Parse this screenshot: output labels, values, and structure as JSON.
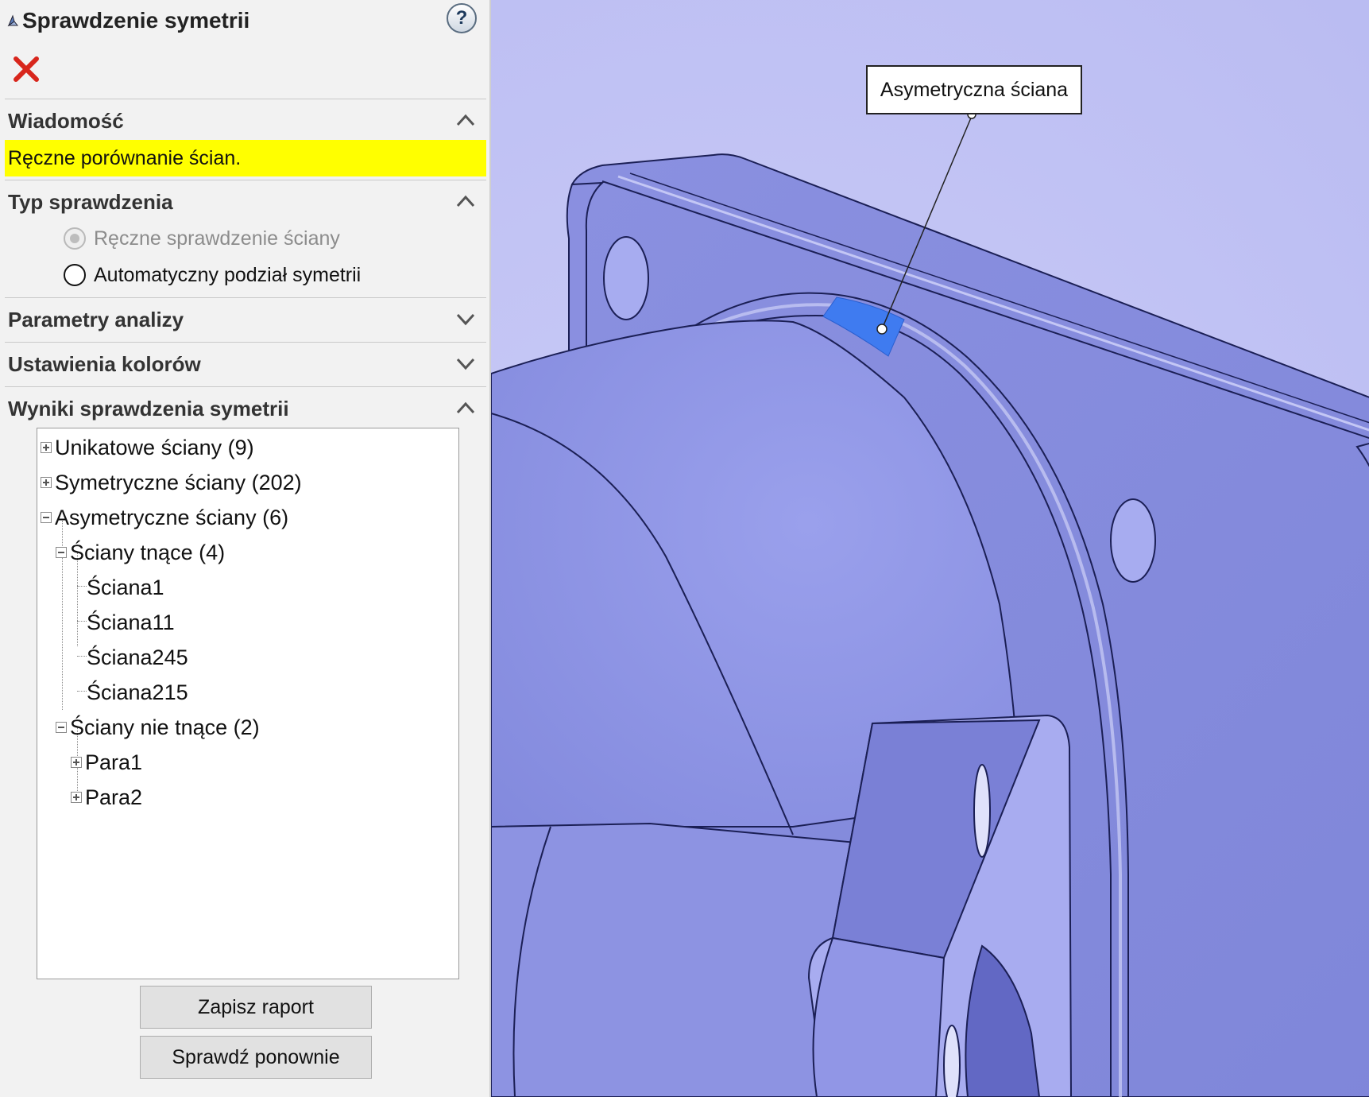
{
  "panel": {
    "title": "Sprawdzenie symetrii",
    "help_label": "?",
    "message": {
      "header": "Wiadomość",
      "text": "Ręczne porównanie ścian."
    },
    "check_type": {
      "header": "Typ sprawdzenia",
      "options": [
        {
          "label": "Ręczne sprawdzenie ściany",
          "selected": true,
          "disabled": true
        },
        {
          "label": "Automatyczny podział symetrii",
          "selected": false,
          "disabled": false
        }
      ]
    },
    "analysis_params": {
      "header": "Parametry analizy"
    },
    "color_settings": {
      "header": "Ustawienia kolorów"
    },
    "results": {
      "header": "Wyniki sprawdzenia symetrii",
      "tree": {
        "unique": "Unikatowe ściany (9)",
        "symmetric": "Symetryczne ściany (202)",
        "asymmetric": "Asymetryczne ściany (6)",
        "cutting": "Ściany tnące (4)",
        "cutting_items": [
          "Ściana1",
          "Ściana11",
          "Ściana245",
          "Ściana215"
        ],
        "non_cutting": "Ściany nie tnące (2)",
        "non_cutting_items": [
          "Para1",
          "Para2"
        ]
      }
    },
    "buttons": {
      "save_report": "Zapisz raport",
      "recheck": "Sprawdź ponownie"
    }
  },
  "viewport": {
    "callout_label": "Asymetryczna ściana",
    "background_color": "#bbbcf3",
    "model_color": "#8e95e6",
    "highlight_color": "#3f7bf0"
  }
}
